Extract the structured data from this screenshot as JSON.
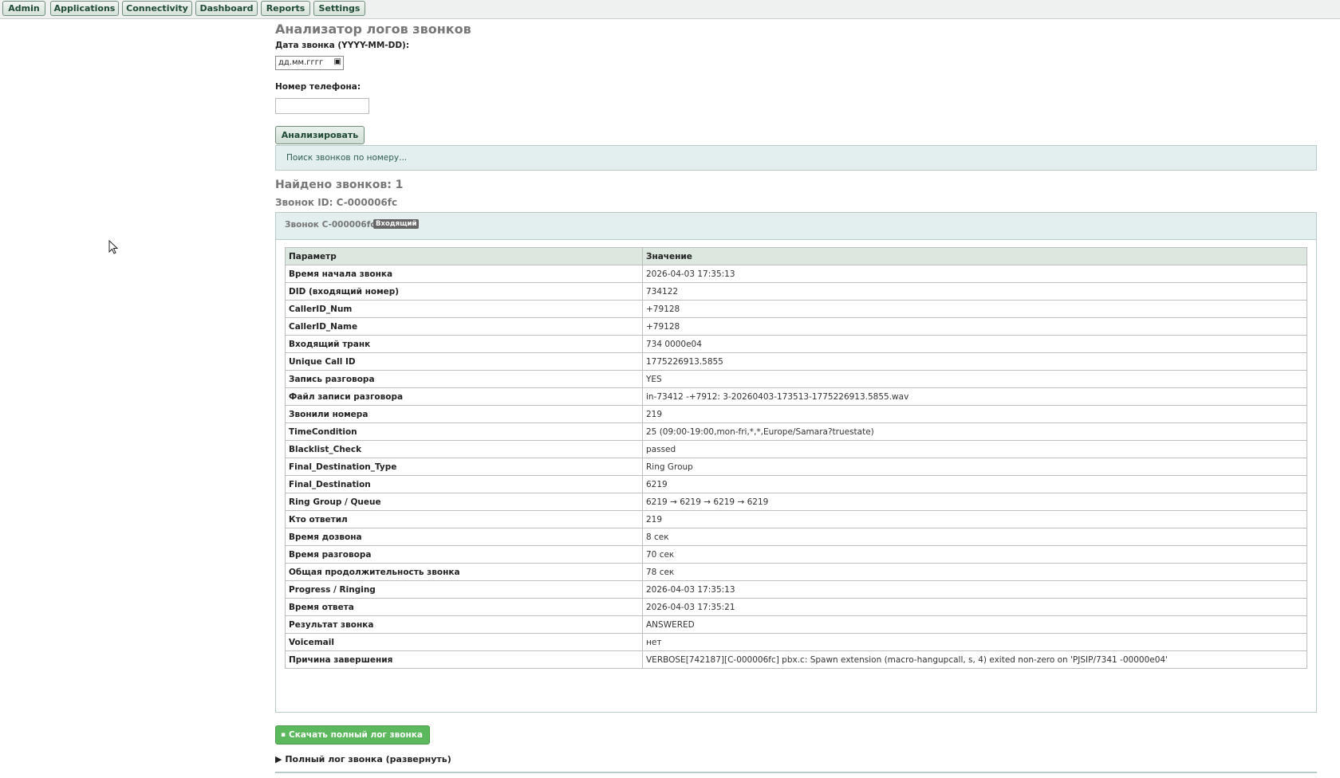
{
  "nav": [
    "Admin",
    "Applications",
    "Connectivity",
    "Dashboard",
    "Reports",
    "Settings"
  ],
  "page_title": "Анализатор логов звонков",
  "form": {
    "date_label": "Дата звонка (YYYY-MM-DD):",
    "date_placeholder": "дд.мм.гггг",
    "phone_label": "Номер телефона:",
    "phone_value": "",
    "analyze_button": "Анализировать"
  },
  "status_message": "Поиск звонков по номеру...",
  "found_count": "Найдено звонков: 1",
  "call_id_title": "Звонок ID: C-000006fc",
  "panel": {
    "title": "Звонок C-000006fc —",
    "badge": "Входящий"
  },
  "table": {
    "headers": [
      "Параметр",
      "Значение"
    ],
    "rows": [
      {
        "param": "Время начала звонка",
        "value": "2026-04-03 17:35:13"
      },
      {
        "param": "DID (входящий номер)",
        "value": "734122"
      },
      {
        "param": "CallerID_Num",
        "value": "+79128"
      },
      {
        "param": "CallerID_Name",
        "value": "+79128"
      },
      {
        "param": "Входящий транк",
        "value": "734     0000e04"
      },
      {
        "param": "Unique Call ID",
        "value": "1775226913.5855"
      },
      {
        "param": "Запись разговора",
        "value": "YES"
      },
      {
        "param": "Файл записи разговора",
        "value": "in-73412          -+7912:         3-20260403-173513-1775226913.5855.wav"
      },
      {
        "param": "Звонили номера",
        "value": "219"
      },
      {
        "param": "TimeCondition",
        "value": "25 (09:00-19:00,mon-fri,*,*,Europe/Samara?truestate)"
      },
      {
        "param": "Blacklist_Check",
        "value": "passed"
      },
      {
        "param": "Final_Destination_Type",
        "value": "Ring Group"
      },
      {
        "param": "Final_Destination",
        "value": "6219"
      },
      {
        "param": "Ring Group / Queue",
        "value": "6219 → 6219 → 6219 → 6219"
      },
      {
        "param": "Кто ответил",
        "value": "219"
      },
      {
        "param": "Время дозвона",
        "value": "8 сек"
      },
      {
        "param": "Время разговора",
        "value": "70 сек"
      },
      {
        "param": "Общая продолжительность звонка",
        "value": "78 сек"
      },
      {
        "param": "Progress / Ringing",
        "value": "2026-04-03 17:35:13"
      },
      {
        "param": "Время ответа",
        "value": "2026-04-03 17:35:21"
      },
      {
        "param": "Результат звонка",
        "value": "ANSWERED"
      },
      {
        "param": "Voicemail",
        "value": "нет"
      },
      {
        "param": "Причина завершения",
        "value": "VERBOSE[742187][C-000006fc] pbx.c: Spawn extension (macro-hangupcall, s, 4) exited non-zero on 'PJSIP/7341           -00000e04'"
      }
    ]
  },
  "download_button": "Скачать полный лог звонка",
  "expander_label": "Полный лог звонка (развернуть)"
}
